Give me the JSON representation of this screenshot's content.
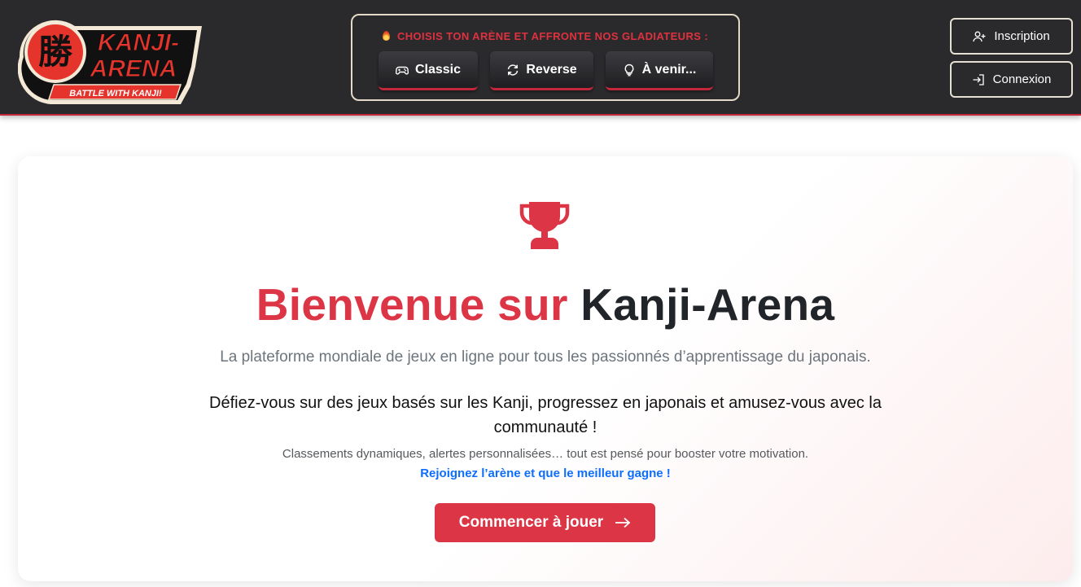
{
  "header": {
    "logo": {
      "kanji": "勝",
      "line1": "KANJI-",
      "line2": "ARENA",
      "tagline": "BATTLE WITH KANJI!"
    },
    "arena": {
      "title": "CHOISIS TON ARÈNE ET AFFRONTE NOS GLADIATEURS :",
      "buttons": [
        {
          "label": "Classic",
          "icon": "gamepad-icon"
        },
        {
          "label": "Reverse",
          "icon": "refresh-icon"
        },
        {
          "label": "À venir...",
          "icon": "lightbulb-icon"
        }
      ]
    },
    "auth": {
      "signup_label": "Inscription",
      "login_label": "Connexion"
    }
  },
  "main": {
    "icon": "trophy-icon",
    "title_part1": "Bienvenue sur",
    "title_part2": "Kanji-Arena",
    "subtitle": "La plateforme mondiale de jeux en ligne pour tous les passionnés d’apprentissage du japonais.",
    "description": "Défiez-vous sur des jeux basés sur les Kanji, progressez en japonais et amusez-vous avec la communauté !",
    "small_text": "Classements dynamiques, alertes personnalisées… tout est pensé pour booster votre motivation.",
    "join_text": "Rejoignez l’arène et que le meilleur gagne !",
    "cta_label": "Commencer à jouer"
  },
  "colors": {
    "header_bg": "#2a2a2d",
    "accent_red": "#dc3545",
    "link_blue": "#0d6efd",
    "text_dark": "#212529"
  }
}
